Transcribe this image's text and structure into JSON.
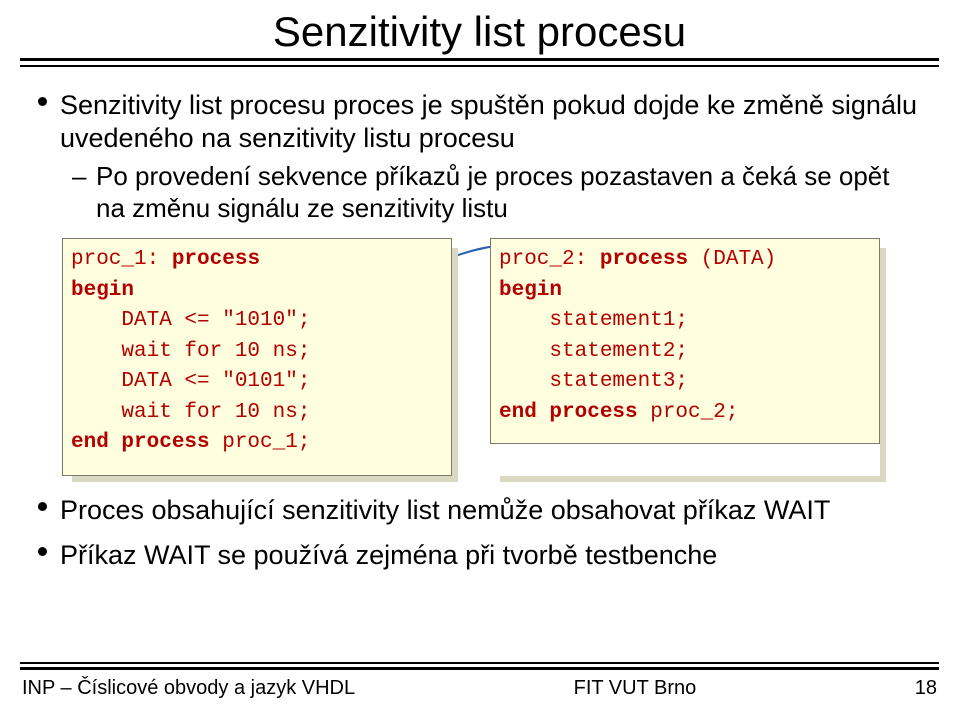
{
  "title": "Senzitivity list procesu",
  "b1_text": "Senzitivity list procesu proces je spuštěn pokud dojde ke změně signálu uvedeného na senzitivity listu procesu",
  "b1_sub": "Po provedení sekvence příkazů je proces pozastaven a čeká se opět na změnu signálu ze senzitivity listu",
  "code_left": {
    "l1a": "proc_1: ",
    "l1b": "process",
    "l2": "begin",
    "l3": "    DATA <= \"1010\";",
    "l4": "    wait for 10 ns;",
    "l5": "    DATA <= \"0101\";",
    "l6": "    wait for 10 ns;",
    "l7a": "end process",
    "l7b": " proc_1;"
  },
  "code_right": {
    "l1a": "proc_2: ",
    "l1b": "process",
    "l1c": " (DATA)",
    "l2": "begin",
    "l3": "    statement1;",
    "l4": "    statement2;",
    "l5": "    statement3;",
    "l6a": "end process",
    "l6b": " proc_2;"
  },
  "b2_text": "Proces obsahující senzitivity list nemůže obsahovat příkaz WAIT",
  "b3_text": "Příkaz WAIT se používá zejména při tvorbě testbenche",
  "footer": {
    "left": "INP – Číslicové obvody a jazyk VHDL",
    "center": "FIT VUT Brno",
    "right": "18"
  },
  "colors": {
    "codebg": "#ffffe0",
    "codefg": "#b30000"
  }
}
